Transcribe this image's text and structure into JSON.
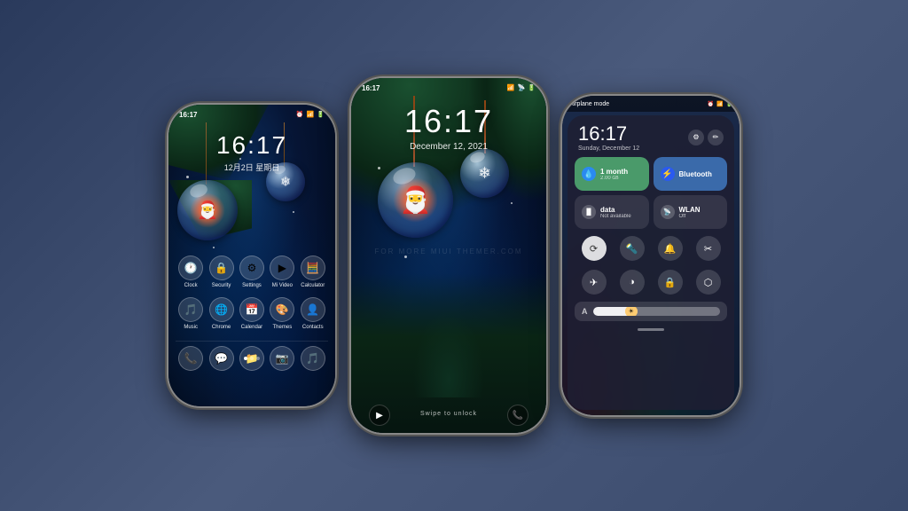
{
  "background": {
    "color_start": "#2a3a5c",
    "color_end": "#3a4a6c"
  },
  "phone1": {
    "type": "home_screen",
    "status_bar": {
      "time": "16:17",
      "icons": [
        "alarm",
        "signal",
        "wifi",
        "battery"
      ]
    },
    "clock": {
      "time": "16:17",
      "date": "12月2日  星期日"
    },
    "app_rows": [
      {
        "apps": [
          {
            "icon": "🕐",
            "label": "Clock"
          },
          {
            "icon": "🔒",
            "label": "Security"
          },
          {
            "icon": "⚙",
            "label": "Settings"
          },
          {
            "icon": "▶",
            "label": "Mi Video"
          },
          {
            "icon": "🧮",
            "label": "Calculator"
          }
        ]
      },
      {
        "apps": [
          {
            "icon": "🎵",
            "label": "Music"
          },
          {
            "icon": "🌐",
            "label": "Chrome"
          },
          {
            "icon": "📅",
            "label": "Calendar"
          },
          {
            "icon": "🎨",
            "label": "Themes"
          },
          {
            "icon": "👤",
            "label": "Contacts"
          }
        ]
      }
    ],
    "dock": [
      {
        "icon": "📞",
        "label": ""
      },
      {
        "icon": "💬",
        "label": ""
      },
      {
        "icon": "📁",
        "label": ""
      },
      {
        "icon": "📷",
        "label": ""
      },
      {
        "icon": "🎵",
        "label": ""
      }
    ]
  },
  "phone2": {
    "type": "lock_screen",
    "status_bar": {
      "time": "16:17",
      "icons": [
        "signal",
        "wifi",
        "battery"
      ]
    },
    "clock": {
      "time": "16:17",
      "date": "December 12, 2021"
    },
    "swipe_hint": "Swipe to unlock",
    "bottom_left_icon": "▶",
    "bottom_right_icon": "📞"
  },
  "phone3": {
    "type": "control_center",
    "airplane_bar": {
      "label": "Airplane mode",
      "icons": [
        "alarm",
        "signal",
        "battery"
      ]
    },
    "clock": {
      "time": "16:17",
      "date": "Sunday, December 12"
    },
    "tiles": [
      {
        "id": "data_tile",
        "icon": "💧",
        "title": "1 month",
        "value": "2.00 GB",
        "style": "green"
      },
      {
        "id": "bluetooth_tile",
        "icon": "⚡",
        "title": "Bluetooth",
        "value": "",
        "style": "blue"
      },
      {
        "id": "data2_tile",
        "icon": "📶",
        "title": "data",
        "value": "Not available",
        "style": "dark"
      },
      {
        "id": "wlan_tile",
        "icon": "📡",
        "title": "WLAN",
        "value": "Off",
        "style": "dark"
      }
    ],
    "buttons_row1": [
      {
        "icon": "⟳",
        "label": "rotate",
        "active": true
      },
      {
        "icon": "🔦",
        "label": "flashlight",
        "active": false
      },
      {
        "icon": "🔔",
        "label": "bell",
        "active": false
      },
      {
        "icon": "✂",
        "label": "screenshot",
        "active": false
      }
    ],
    "buttons_row2": [
      {
        "icon": "✈",
        "label": "airplane",
        "active": false
      },
      {
        "icon": "◑",
        "label": "contrast",
        "active": false
      },
      {
        "icon": "🔒",
        "label": "lock",
        "active": false
      },
      {
        "icon": "⬡",
        "label": "location",
        "active": false
      }
    ],
    "brightness": {
      "label": "A",
      "level": 35
    }
  },
  "watermark": "FOR MORE MIUI THEMER.COM"
}
